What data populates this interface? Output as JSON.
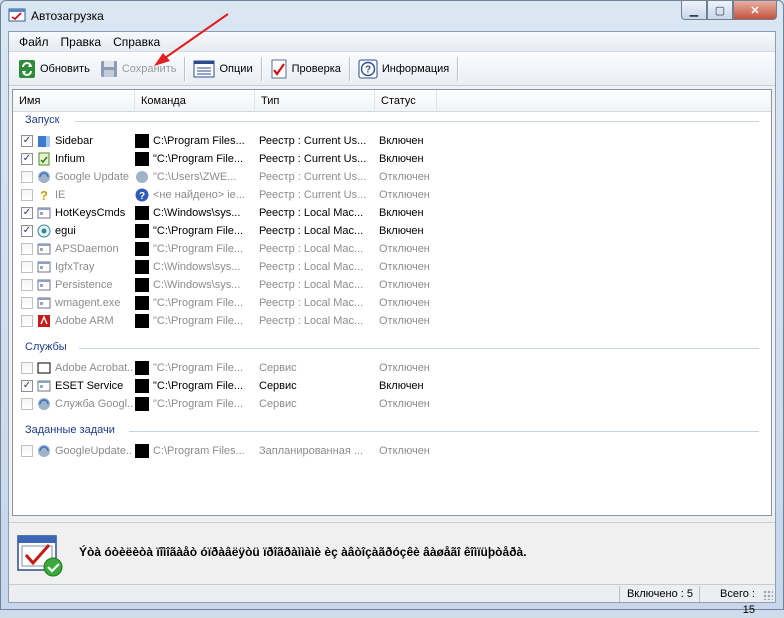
{
  "window": {
    "title": "Автозагрузка"
  },
  "menu": [
    "Файл",
    "Правка",
    "Справка"
  ],
  "toolbar": {
    "refresh": "Обновить",
    "save": "Сохранить",
    "options": "Опции",
    "check": "Проверка",
    "info": "Информация"
  },
  "columns": [
    "Имя",
    "Команда",
    "Тип",
    "Статус"
  ],
  "groups": {
    "startup": {
      "title": "Запуск",
      "rows": [
        {
          "name": "Sidebar",
          "command": "C:\\Program Files...",
          "type": "Реестр : Current Us...",
          "status": "Включен",
          "checked": "✓",
          "icon": "sidebar-icon",
          "enabled": true,
          "black": true
        },
        {
          "name": "Infium",
          "command": "\"C:\\Program File...",
          "type": "Реестр : Current Us...",
          "status": "Включен",
          "checked": "✓",
          "icon": "infium-icon",
          "enabled": true,
          "black": true
        },
        {
          "name": "Google Update",
          "command": "\"C:\\Users\\ZWE...",
          "type": "Реестр : Current Us...",
          "status": "Отключен",
          "checked": "",
          "icon": "google-update-icon",
          "enabled": false,
          "black": false
        },
        {
          "name": "IE",
          "command": "<не найдено> ie...",
          "type": "Реестр : Current Us...",
          "status": "Отключен",
          "checked": "",
          "icon": "question-icon",
          "enabled": false,
          "black": false
        },
        {
          "name": "HotKeysCmds",
          "command": "C:\\Windows\\sys...",
          "type": "Реестр : Local Mac...",
          "status": "Включен",
          "checked": "✓",
          "icon": "app-window-icon",
          "enabled": true,
          "black": true
        },
        {
          "name": "egui",
          "command": "\"C:\\Program File...",
          "type": "Реестр : Local Mac...",
          "status": "Включен",
          "checked": "✓",
          "icon": "eset-icon",
          "enabled": true,
          "black": true
        },
        {
          "name": "APSDaemon",
          "command": "\"C:\\Program File...",
          "type": "Реестр : Local Mac...",
          "status": "Отключен",
          "checked": "",
          "icon": "app-window-icon",
          "enabled": false,
          "black": true
        },
        {
          "name": "IgfxTray",
          "command": "C:\\Windows\\sys...",
          "type": "Реестр : Local Mac...",
          "status": "Отключен",
          "checked": "",
          "icon": "app-window-icon",
          "enabled": false,
          "black": true
        },
        {
          "name": "Persistence",
          "command": "C:\\Windows\\sys...",
          "type": "Реестр : Local Mac...",
          "status": "Отключен",
          "checked": "",
          "icon": "app-window-icon",
          "enabled": false,
          "black": true
        },
        {
          "name": "wmagent.exe",
          "command": "\"C:\\Program File...",
          "type": "Реестр : Local Mac...",
          "status": "Отключен",
          "checked": "",
          "icon": "app-window-icon",
          "enabled": false,
          "black": true
        },
        {
          "name": "Adobe ARM",
          "command": "\"C:\\Program File...",
          "type": "Реестр : Local Mac...",
          "status": "Отключен",
          "checked": "",
          "icon": "adobe-icon",
          "enabled": false,
          "black": true
        }
      ]
    },
    "services": {
      "title": "Службы",
      "rows": [
        {
          "name": "Adobe Acrobat...",
          "command": "\"C:\\Program File...",
          "type": "Сервис",
          "status": "Отключен",
          "checked": "",
          "icon": "blank-window-icon",
          "enabled": false,
          "black": true
        },
        {
          "name": "ESET Service",
          "command": "\"C:\\Program File...",
          "type": "Сервис",
          "status": "Включен",
          "checked": "✓",
          "icon": "app-window-icon",
          "enabled": true,
          "black": true
        },
        {
          "name": "Служба Googl...",
          "command": "\"C:\\Program File...",
          "type": "Сервис",
          "status": "Отключен",
          "checked": "",
          "icon": "google-update-icon",
          "enabled": false,
          "black": true
        }
      ]
    },
    "tasks": {
      "title": "Заданные задачи",
      "rows": [
        {
          "name": "GoogleUpdate...",
          "command": "C:\\Program Files...",
          "type": "Запланированная ...",
          "status": "Отключен",
          "checked": "",
          "icon": "google-update-icon",
          "enabled": false,
          "black": true
        }
      ]
    }
  },
  "description": "Ýòà óòèëèòà ïîìîãàåò óïðàâëÿòü ïðîãðàììàìè èç àâòîçàãðóçêè âàøåãî êîìïüþòåðà.",
  "statusbar": {
    "enabled_count": "Включено : 5",
    "total_count": "Всего : 15"
  },
  "colors": {
    "accent": "#1e3c8c",
    "annotation_arrow": "#e02020"
  }
}
